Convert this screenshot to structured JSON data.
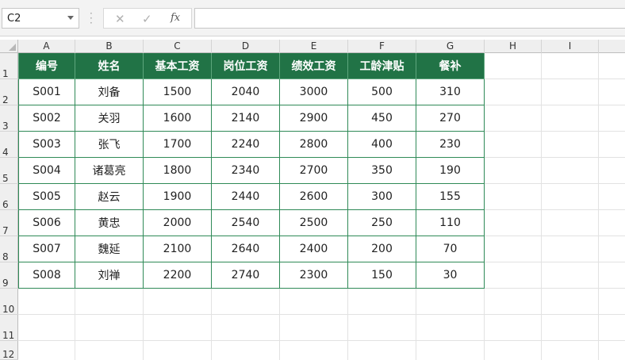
{
  "formula_bar": {
    "name_box": "C2",
    "cancel_icon": "✕",
    "enter_icon": "✓",
    "fx_label": "fx",
    "formula": ""
  },
  "columns": [
    "A",
    "B",
    "C",
    "D",
    "E",
    "F",
    "G",
    "H",
    "I"
  ],
  "rows": [
    "1",
    "2",
    "3",
    "4",
    "5",
    "6",
    "7",
    "8",
    "9",
    "10",
    "11",
    "12"
  ],
  "table": {
    "headers": [
      "编号",
      "姓名",
      "基本工资",
      "岗位工资",
      "绩效工资",
      "工龄津贴",
      "餐补"
    ],
    "rows": [
      [
        "S001",
        "刘备",
        "1500",
        "2040",
        "3000",
        "500",
        "310"
      ],
      [
        "S002",
        "关羽",
        "1600",
        "2140",
        "2900",
        "450",
        "270"
      ],
      [
        "S003",
        "张飞",
        "1700",
        "2240",
        "2800",
        "400",
        "230"
      ],
      [
        "S004",
        "诸葛亮",
        "1800",
        "2340",
        "2700",
        "350",
        "190"
      ],
      [
        "S005",
        "赵云",
        "1900",
        "2440",
        "2600",
        "300",
        "155"
      ],
      [
        "S006",
        "黄忠",
        "2000",
        "2540",
        "2500",
        "250",
        "110"
      ],
      [
        "S007",
        "魏延",
        "2100",
        "2640",
        "2400",
        "200",
        "70"
      ],
      [
        "S008",
        "刘禅",
        "2200",
        "2740",
        "2300",
        "150",
        "30"
      ]
    ]
  },
  "colors": {
    "header_fill": "#217346",
    "border": "#2f8a57"
  }
}
